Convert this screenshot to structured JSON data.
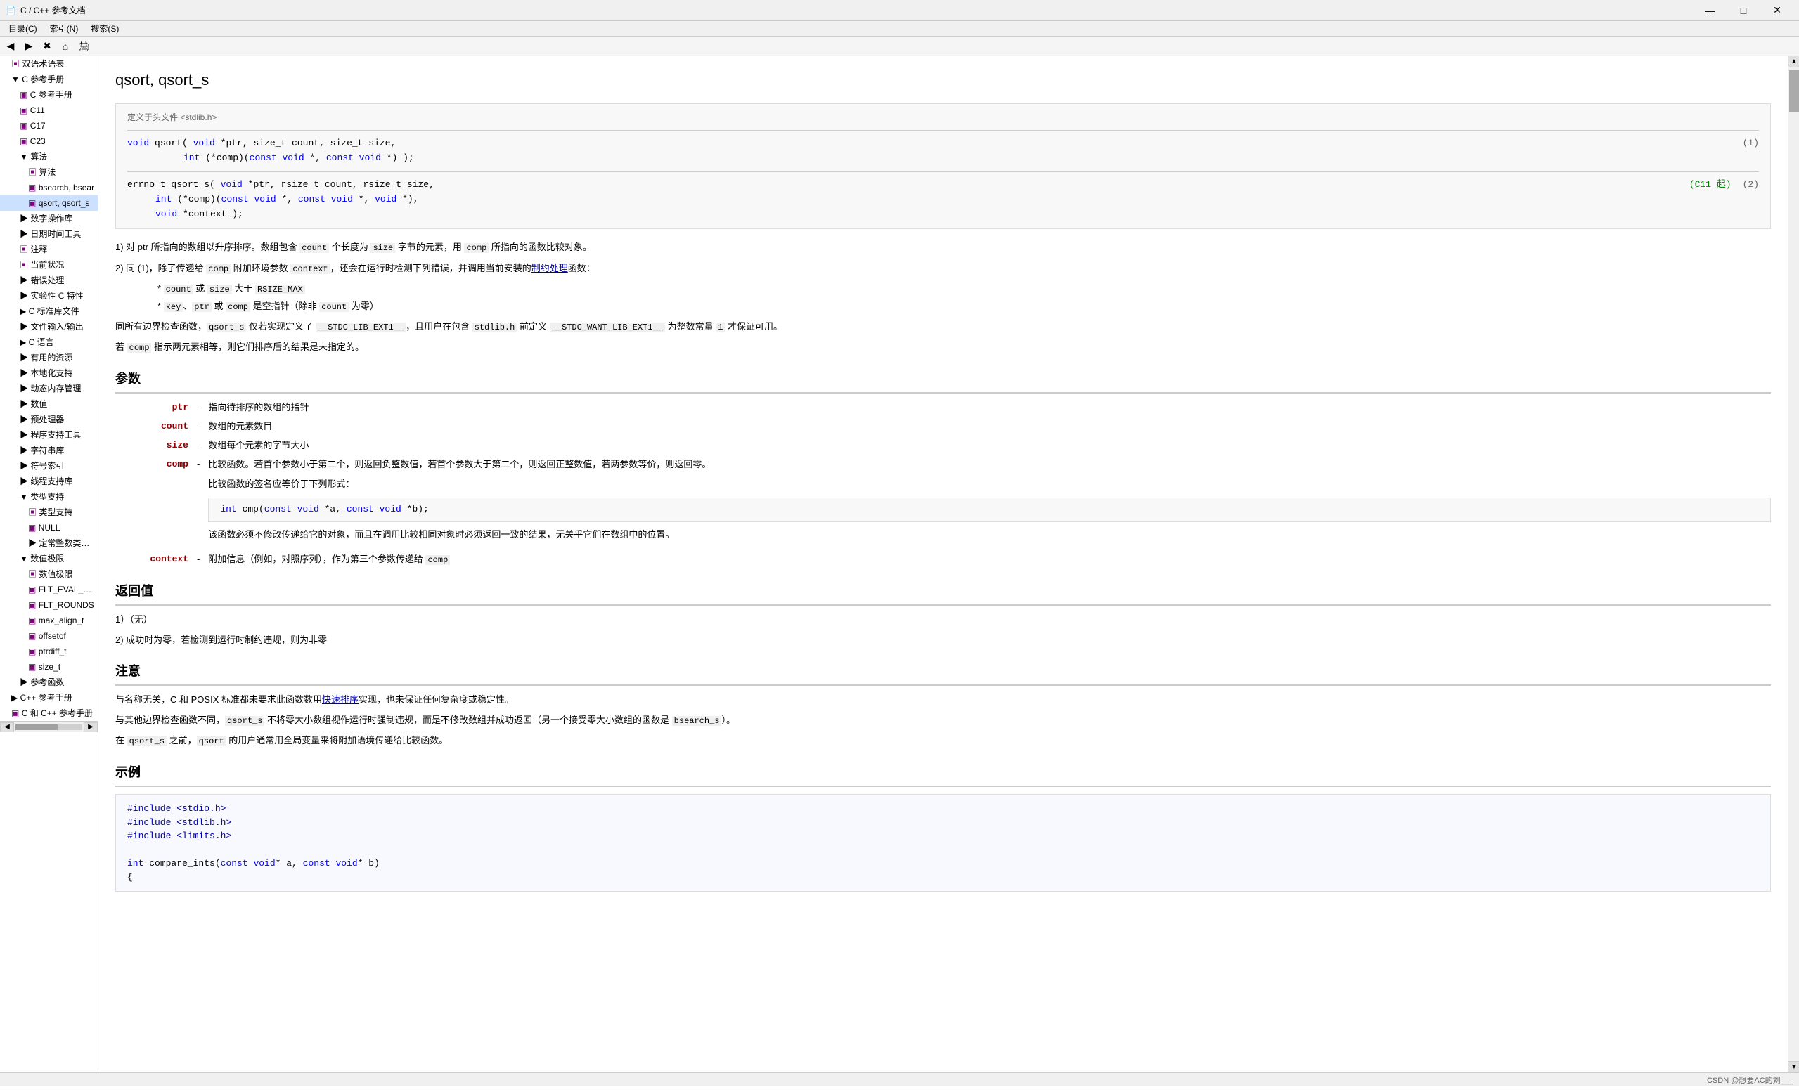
{
  "titlebar": {
    "title": "C / C++ 参考文档",
    "icon": "📄",
    "controls": [
      "—",
      "□",
      "✕"
    ]
  },
  "menubar": {
    "items": [
      "目录(C)",
      "索引(N)",
      "搜索(S)"
    ]
  },
  "toolbar": {
    "buttons": [
      "←",
      "→",
      "⟳",
      "🏠",
      "🖨"
    ]
  },
  "tabs": [
    {
      "label": "目录(C)",
      "active": false
    },
    {
      "label": "索引(N)",
      "active": false
    },
    {
      "label": "搜索(S)",
      "active": false
    }
  ],
  "sidebar": {
    "items": [
      {
        "label": "双语术语表",
        "indent": 1,
        "icon": "▣",
        "expanded": false
      },
      {
        "label": "C 参考手册",
        "indent": 1,
        "icon": "▼",
        "expanded": true
      },
      {
        "label": "C 参考手册",
        "indent": 2,
        "icon": "▣"
      },
      {
        "label": "C11",
        "indent": 2,
        "icon": "▣"
      },
      {
        "label": "C17",
        "indent": 2,
        "icon": "▣"
      },
      {
        "label": "C23",
        "indent": 2,
        "icon": "▣"
      },
      {
        "label": "算法",
        "indent": 2,
        "icon": "▼",
        "expanded": true
      },
      {
        "label": "算法",
        "indent": 3,
        "icon": "▣"
      },
      {
        "label": "bsearch, bsear",
        "indent": 3,
        "icon": "▣"
      },
      {
        "label": "qsort, qsort_s",
        "indent": 3,
        "icon": "▣",
        "selected": true
      },
      {
        "label": "数字操作库",
        "indent": 2,
        "icon": "▶"
      },
      {
        "label": "日期时间工具",
        "indent": 2,
        "icon": "▶"
      },
      {
        "label": "注释",
        "indent": 2,
        "icon": "▣"
      },
      {
        "label": "当前状况",
        "indent": 2,
        "icon": "▣"
      },
      {
        "label": "错误处理",
        "indent": 2,
        "icon": "▶"
      },
      {
        "label": "实验性 C 特性",
        "indent": 2,
        "icon": "▶"
      },
      {
        "label": "C 标准库文件",
        "indent": 2,
        "icon": "▶"
      },
      {
        "label": "文件输入/输出",
        "indent": 2,
        "icon": "▶"
      },
      {
        "label": "C 语言",
        "indent": 2,
        "icon": "▶"
      },
      {
        "label": "有用的资源",
        "indent": 2,
        "icon": "▶"
      },
      {
        "label": "本地化支持",
        "indent": 2,
        "icon": "▶"
      },
      {
        "label": "动态内存管理",
        "indent": 2,
        "icon": "▶"
      },
      {
        "label": "数值",
        "indent": 2,
        "icon": "▶"
      },
      {
        "label": "预处理器",
        "indent": 2,
        "icon": "▶"
      },
      {
        "label": "程序支持工具",
        "indent": 2,
        "icon": "▶"
      },
      {
        "label": "字符串库",
        "indent": 2,
        "icon": "▶"
      },
      {
        "label": "符号索引",
        "indent": 2,
        "icon": "▶"
      },
      {
        "label": "线程支持库",
        "indent": 2,
        "icon": "▶"
      },
      {
        "label": "类型支持",
        "indent": 2,
        "icon": "▼",
        "expanded": true
      },
      {
        "label": "类型支持",
        "indent": 3,
        "icon": "▣"
      },
      {
        "label": "NULL",
        "indent": 3,
        "icon": "▣"
      },
      {
        "label": "定常整数类型（",
        "indent": 3,
        "icon": "▶"
      },
      {
        "label": "数值极限",
        "indent": 2,
        "icon": "▼",
        "expanded": true
      },
      {
        "label": "数值极限",
        "indent": 3,
        "icon": "▣"
      },
      {
        "label": "FLT_EVAL_ME",
        "indent": 3,
        "icon": "▣"
      },
      {
        "label": "FLT_ROUNDS",
        "indent": 3,
        "icon": "▣"
      },
      {
        "label": "max_align_t",
        "indent": 3,
        "icon": "▣"
      },
      {
        "label": "offsetof",
        "indent": 3,
        "icon": "▣"
      },
      {
        "label": "ptrdiff_t",
        "indent": 3,
        "icon": "▣"
      },
      {
        "label": "size_t",
        "indent": 3,
        "icon": "▣"
      },
      {
        "label": "参考函数",
        "indent": 2,
        "icon": "▶"
      },
      {
        "label": "C++ 参考手册",
        "indent": 1,
        "icon": "▶"
      },
      {
        "label": "C 和 C++ 参考手册",
        "indent": 1,
        "icon": "▣"
      }
    ]
  },
  "content": {
    "page_title": "qsort, qsort_s",
    "def_header": "定义于头文件 <stdlib.h>",
    "sig1": "void qsort( void *ptr, size_t count, size_t size,",
    "sig1b": "            int (*comp)(const void *, const void *) );",
    "sig1_num": "(1)",
    "sig2": "errno_t qsort_s( void *ptr, rsize_t count, rsize_t size,",
    "sig2b": "    int (*comp)(const void *, const void *,",
    "sig2c": "    void *context );",
    "sig2_num": "(2)",
    "sig2_c11": "(C11 起)",
    "desc1": "1) 对 ptr 所指向的数组以升序排序。数组包含 count 个长度为 size 字节的元素，用 comp 所指向的函数比较对象。",
    "desc2": "2) 同 (1)，除了传递给 comp 附加环境参数 context，还会在运行时检测下列错误，并调用当前安装的制约处理函数：",
    "desc2_bullet1": "* count 或 size 大于 RSIZE_MAX",
    "desc2_bullet2": "* key、ptr 或 comp 是空指针（除非 count 为零）",
    "desc2_note": "同所有边界检查函数，qsort_s 仅若实现定义了 __STDC_LIB_EXT1__，且用户在包含 stdlib.h 前定义 __STDC_WANT_LIB_EXT1__ 为整数常量 1 才保证可用。",
    "desc3": "若 comp 指示两元素相等，则它们排序后的结果是未指定的。",
    "params_title": "参数",
    "param_ptr_name": "ptr",
    "param_ptr_desc": "指向待排序的数组的指针",
    "param_count_name": "count",
    "param_count_desc": "数组的元素数目",
    "param_size_name": "size",
    "param_size_desc": "数组每个元素的字节大小",
    "param_comp_name": "comp",
    "param_comp_desc1": "比较函数。若首个参数小于第二个，则返回负整数值，若首个参数大于第二个，则返回正整数值，若两参数等价，则返回零。",
    "param_comp_desc2": "比较函数的签名应等价于下列形式：",
    "comp_sig": "    int cmp(const void *a, const void *b);",
    "param_comp_desc3": "该函数必须不修改传递给它的对象，而且在调用比较相同对象时必须返回一致的结果，无关乎它们在数组中的位置。",
    "param_context_name": "context",
    "param_context_desc": "附加信息（例如，对照序列），作为第三个参数传递给 comp",
    "return_title": "返回值",
    "return1": "1）（无）",
    "return2": "2) 成功时为零，若检测到运行时制约违规，则为非零",
    "note_title": "注意",
    "note1": "与名称无关，C 和 POSIX 标准都未要求此函数数用快速排序实现，也未保证任何复杂度或稳定性。",
    "note2": "与其他边界检查函数不同，qsort_s 不将零大小数组视作运行时强制违规，而是不修改数组并成功返回（另一个接受零大小数组的函数是 bsearch_s）。",
    "note3": "在 qsort_s 之前，qsort 的用户通常用全局变量来将附加语境传递给比较函数。",
    "example_title": "示例",
    "example_code": [
      "#include <stdio.h>",
      "#include <stdlib.h>",
      "#include <limits.h>",
      "",
      "int compare_ints(const void* a, const void* b)"
    ],
    "statusbar": "CSDN @想要AC的刘___"
  }
}
